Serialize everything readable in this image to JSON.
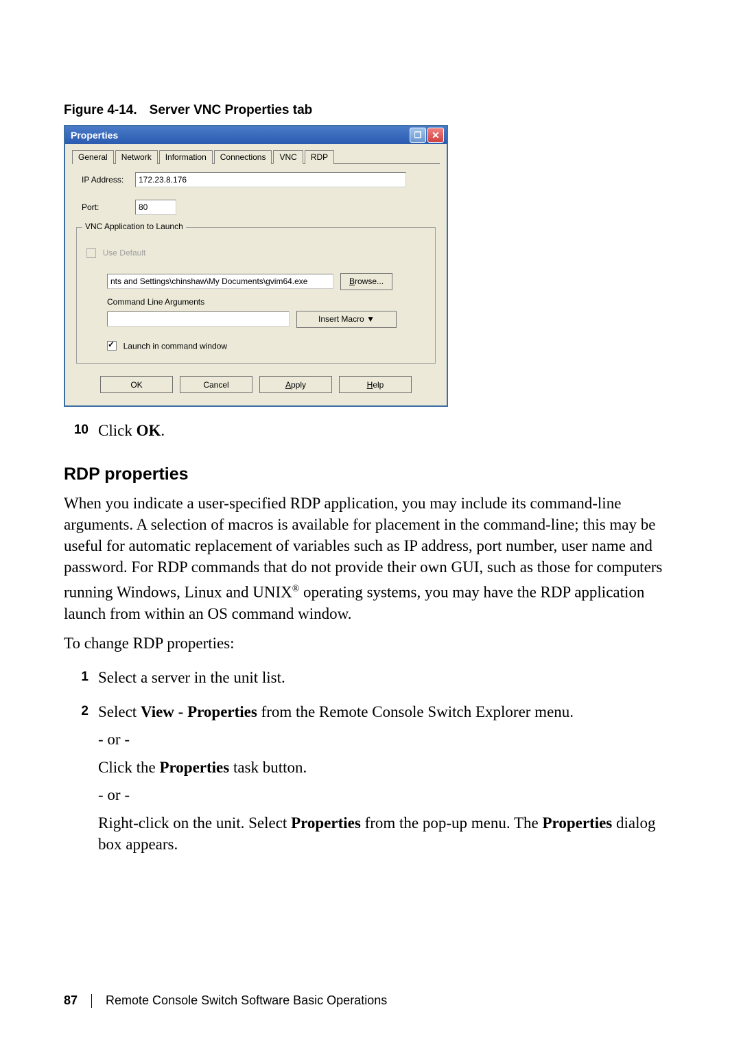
{
  "figure": {
    "label_num": "Figure 4-14.",
    "label_text": "Server VNC Properties tab"
  },
  "dlg": {
    "title": "Properties",
    "tabs": [
      "General",
      "Network",
      "Information",
      "Connections",
      "VNC",
      "RDP"
    ],
    "ip_label": "IP Address:",
    "ip_value": "172.23.8.176",
    "port_label": "Port:",
    "port_value": "80",
    "group_title": "VNC Application to Launch",
    "use_default": "Use Default",
    "path": "nts and Settings\\chinshaw\\My Documents\\gvim64.exe",
    "browse": "rowse...",
    "browse_ul": "B",
    "cla": "Command Line Arguments",
    "cla_value": "",
    "macro": "Insert Macro ▼",
    "launch": "Launch in command window",
    "ok": "OK",
    "cancel": "Cancel",
    "apply": "pply",
    "apply_ul": "A",
    "help": "elp",
    "help_ul": "H"
  },
  "step10": {
    "n": "10",
    "t1": "Click ",
    "t2": "OK",
    "t3": "."
  },
  "h2": "RDP properties",
  "para1": "When you indicate a user-specified RDP application, you may include its command-line arguments. A selection of macros is available for placement in the command-line; this may be useful for automatic replacement of variables such as IP address, port number, user name and password. For RDP commands that do not provide their own GUI, such as those for computers running Windows, Linux and UNIX",
  "para1b": " operating systems, you may have the RDP application launch from within an OS command window.",
  "para2": "To change RDP properties:",
  "s1": {
    "n": "1",
    "t": "Select a server in the unit list."
  },
  "s2": {
    "n": "2",
    "t1": "Select ",
    "t2": "View - Properties",
    "t3": " from the Remote Console Switch Explorer menu."
  },
  "or": "- or -",
  "sub1a": "Click the ",
  "sub1b": "Properties",
  "sub1c": " task button.",
  "sub2a": "Right-click on the unit. Select ",
  "sub2b": "Properties",
  "sub2c": " from the pop-up menu. The ",
  "sub2d": "Properties",
  "sub2e": " dialog box appears.",
  "footer": {
    "page": "87",
    "title": "Remote Console Switch Software Basic Operations"
  }
}
